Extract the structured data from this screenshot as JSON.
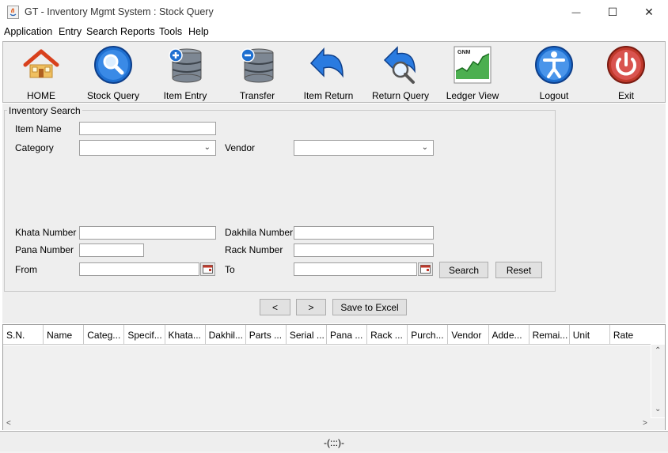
{
  "window": {
    "title": "GT - Inventory Mgmt System : Stock Query",
    "minimize_glyph": "—",
    "maximize_glyph": "☐",
    "close_glyph": "✕"
  },
  "menu": [
    "Application",
    "Entry",
    "Search",
    "Reports",
    "Tools",
    "Help"
  ],
  "toolbar": [
    {
      "label": "HOME",
      "icon": "home-icon"
    },
    {
      "label": "Stock Query",
      "icon": "magnifier-icon"
    },
    {
      "label": "Item Entry",
      "icon": "database-add-icon"
    },
    {
      "label": "Transfer",
      "icon": "database-remove-icon"
    },
    {
      "label": "Item Return",
      "icon": "return-arrow-icon"
    },
    {
      "label": "Return Query",
      "icon": "return-search-icon"
    },
    {
      "label": "Ledger View",
      "icon": "ledger-chart-icon",
      "icon_text": "GNM"
    },
    {
      "label": "Logout",
      "icon": "logout-person-icon"
    },
    {
      "label": "Exit",
      "icon": "power-icon"
    }
  ],
  "search_panel": {
    "title": "Inventory Search",
    "item_name_label": "Item Name",
    "item_name_value": "",
    "category_label": "Category",
    "category_value": "",
    "vendor_label": "Vendor",
    "vendor_value": "",
    "khata_label": "Khata Number",
    "khata_value": "",
    "dakhila_label": "Dakhila Number",
    "dakhila_value": "",
    "pana_label": "Pana Number",
    "pana_value": "",
    "rack_label": "Rack Number",
    "rack_value": "",
    "from_label": "From",
    "from_value": "",
    "to_label": "To",
    "to_value": "",
    "search_button": "Search",
    "reset_button": "Reset"
  },
  "pager": {
    "prev": "<",
    "next": ">",
    "save_excel": "Save to Excel"
  },
  "table": {
    "columns": [
      "S.N.",
      "Name",
      "Categ...",
      "Specif...",
      "Khata...",
      "Dakhil...",
      "Parts ...",
      "Serial ...",
      "Pana ...",
      "Rack ...",
      "Purch...",
      "Vendor",
      "Adde...",
      "Remai...",
      "Unit",
      "Rate"
    ],
    "rows": []
  },
  "status": "-(:::)-",
  "colors": {
    "panel_bg": "#eeeeee",
    "accent_blue": "#1e6fd0",
    "exit_red": "#c0392b"
  }
}
